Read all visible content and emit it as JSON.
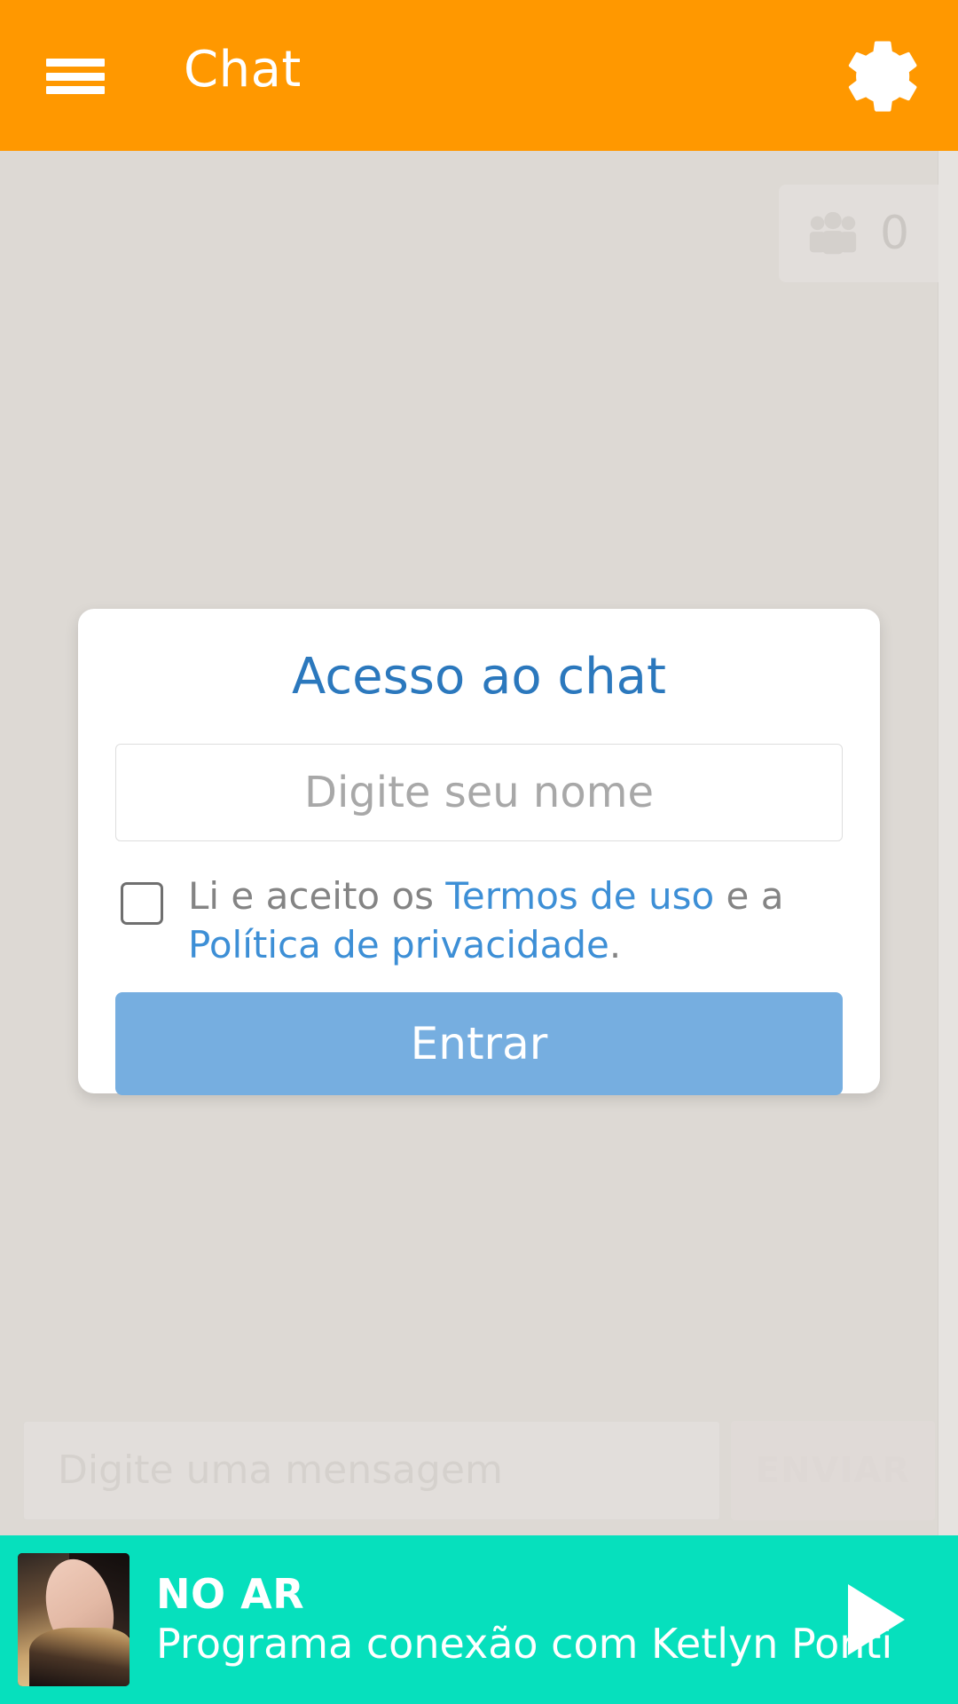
{
  "header": {
    "title": "Chat",
    "menu_icon": "hamburger-menu-icon",
    "settings_icon": "gear-icon",
    "background_color": "#ff9800"
  },
  "chat": {
    "users_badge": {
      "icon": "users-group-icon",
      "count": "0"
    },
    "composer": {
      "placeholder": "Digite uma mensagem",
      "send_label": "ENVIAR"
    }
  },
  "login_modal": {
    "title": "Acesso ao chat",
    "title_color": "#2b78bd",
    "name_field": {
      "value": "",
      "placeholder": "Digite seu nome"
    },
    "terms": {
      "checked": false,
      "prefix": "Li e aceito os ",
      "terms_link": "Termos de uso",
      "middle": " e a ",
      "privacy_link": "Política de privacidade",
      "suffix": ".",
      "link_color": "#3d8fd6"
    },
    "submit_label": "Entrar",
    "submit_color": "#76aee0"
  },
  "player": {
    "status": "NO AR",
    "program": "Programa conexão com Ketlyn Ponti",
    "play_icon": "play-icon",
    "background_color": "#06e0bd"
  }
}
